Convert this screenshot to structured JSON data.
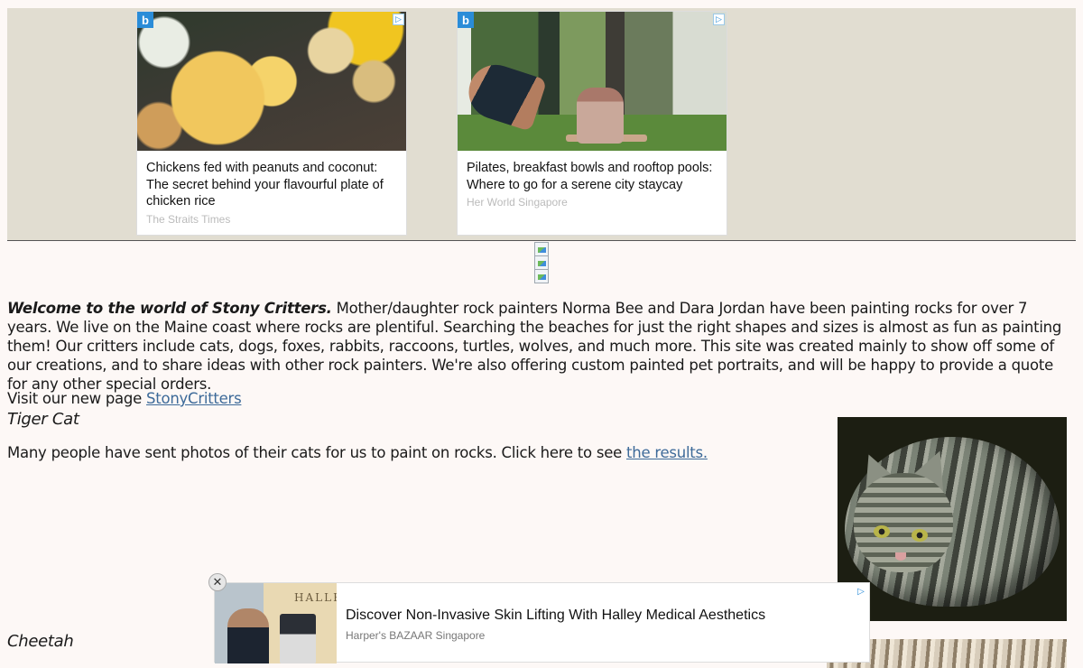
{
  "top_ads": [
    {
      "headline": "Chickens fed with peanuts and coconut: The secret behind your flavourful plate of chicken rice",
      "source": "The Straits Times",
      "image": "chicken-rice-photo"
    },
    {
      "headline": "Pilates, breakfast bowls and rooftop pools: Where to go for a serene city staycay",
      "source": "Her World Singapore",
      "image": "pilates-photo"
    }
  ],
  "ad_icons": {
    "logo": "b-logo-icon",
    "logo_char": "b",
    "adchoice": "adchoices-icon",
    "adchoice_char": "▷"
  },
  "intro": {
    "bold": "Welcome to the world of Stony Critters.",
    "text": " Mother/daughter rock painters Norma Bee and Dara Jordan have been painting rocks for over 7 years. We live on the Maine coast where rocks are plentiful. Searching the beaches for just the right shapes and sizes is almost as fun as painting them! Our critters include cats, dogs, foxes, rabbits, raccoons, turtles, wolves, and much more. This site was created mainly to show off some of our creations, and to share ideas with other rock painters. We're also offering custom painted pet portraits, and will be happy to provide a quote for any other special orders."
  },
  "visit": {
    "prefix": "Visit our new page ",
    "link": "StonyCritters"
  },
  "sections": [
    {
      "title": "Tiger Cat",
      "desc_prefix": "Many people have sent photos of their cats for us to paint on rocks. Click here to see ",
      "desc_link": "the results."
    },
    {
      "title": "Cheetah"
    }
  ],
  "float_ad": {
    "title": "Discover Non-Invasive Skin Lifting With Halley Medical Aesthetics",
    "source": "Harper's BAZAAR Singapore",
    "brand": "HALLEY",
    "close_char": "✕"
  },
  "colors": {
    "link": "#3d6a99",
    "ad_strip_bg": "#e1ddd1",
    "page_bg": "#fdf8f6"
  }
}
